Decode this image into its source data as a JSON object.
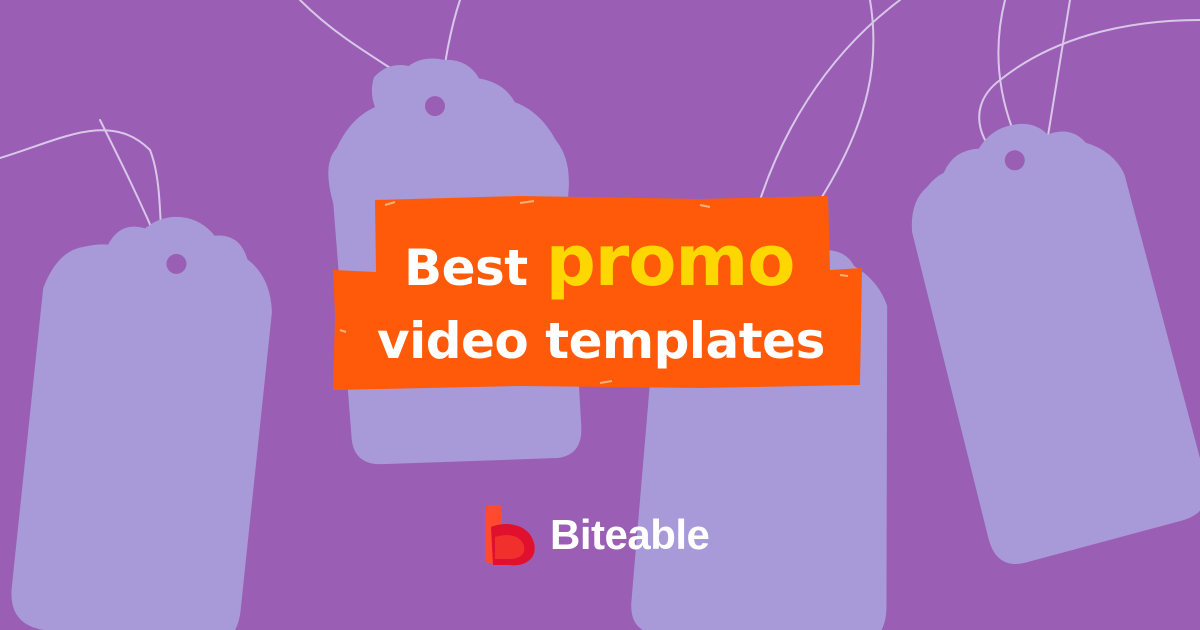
{
  "headline": {
    "word1": "Best",
    "word2": "promo",
    "line2": "video templates"
  },
  "brand": {
    "name": "Biteable",
    "logo_icon": "biteable-b-logo-icon"
  },
  "colors": {
    "background": "#9a5fb4",
    "tag_fill": "#a89ad8",
    "banner": "#ff5a0a",
    "highlight_text": "#ffd700",
    "text": "#ffffff",
    "logo_primary": "#ff4a2e",
    "logo_secondary": "#e0102e"
  },
  "image_elements": [
    "price-tag-icon",
    "price-tag-icon",
    "price-tag-icon",
    "price-tag-icon"
  ]
}
